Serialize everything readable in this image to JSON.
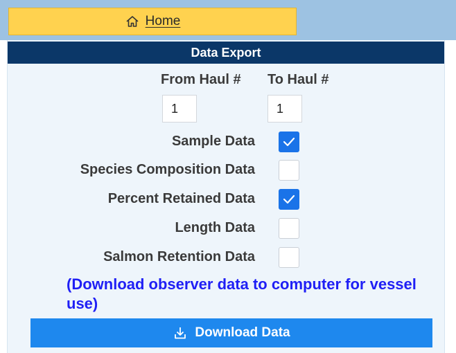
{
  "nav": {
    "home_label": "Home"
  },
  "panel": {
    "title": "Data Export"
  },
  "haul": {
    "from_label": "From Haul #",
    "to_label": "To Haul #",
    "from_value": "1",
    "to_value": "1"
  },
  "options": [
    {
      "label": "Sample Data",
      "checked": true
    },
    {
      "label": "Species Composition Data",
      "checked": false
    },
    {
      "label": "Percent Retained Data",
      "checked": true
    },
    {
      "label": "Length Data",
      "checked": false
    },
    {
      "label": "Salmon Retention Data",
      "checked": false
    }
  ],
  "note": "(Download observer data to computer for vessel use)",
  "download_label": "Download Data",
  "colors": {
    "home_bg": "#ffd24f",
    "header_bg": "#0b3768",
    "panel_bg": "#eef5fb",
    "accent": "#1a73e8",
    "note_text": "#1f1ff5",
    "download_bg": "#1e88ee"
  },
  "icons": {
    "home": "home-icon",
    "download": "download-icon",
    "check": "check-icon"
  }
}
